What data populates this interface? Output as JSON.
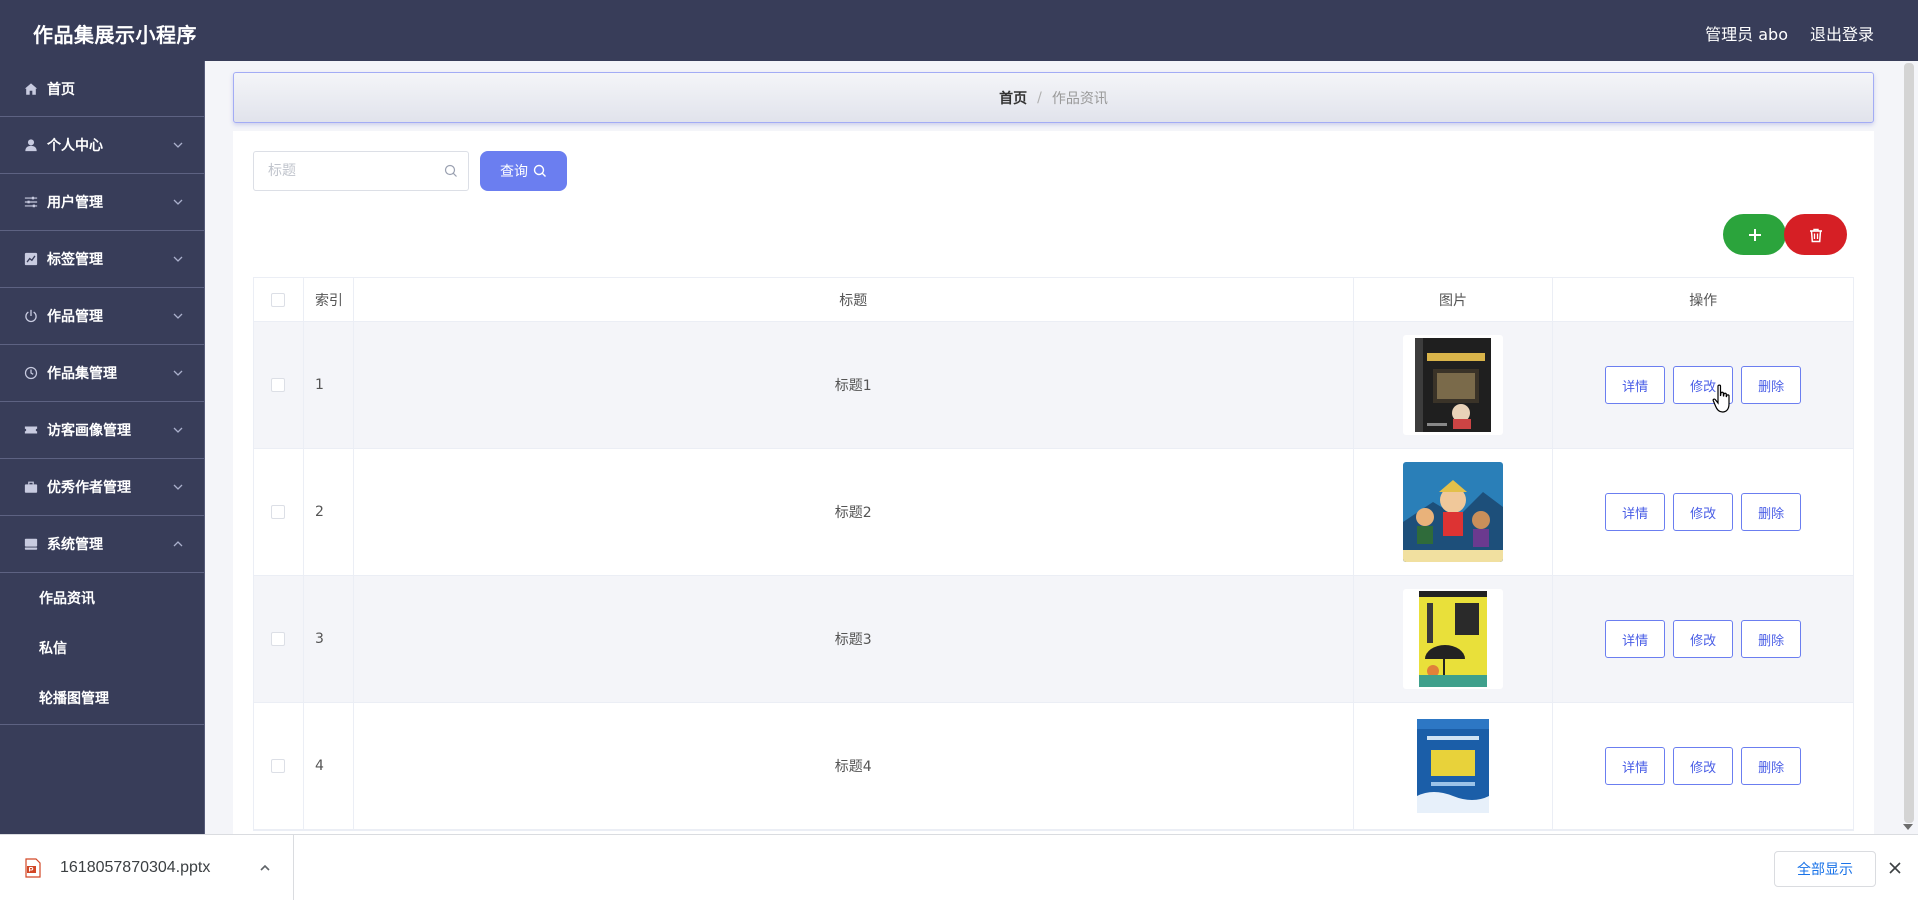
{
  "header": {
    "app_title": "作品集展示小程序",
    "user_text": "管理员 abo",
    "logout_label": "退出登录"
  },
  "sidebar": {
    "items": [
      {
        "label": "首页",
        "icon": "home-icon"
      },
      {
        "label": "个人中心",
        "icon": "user-icon"
      },
      {
        "label": "用户管理",
        "icon": "sliders-icon"
      },
      {
        "label": "标签管理",
        "icon": "chart-icon"
      },
      {
        "label": "作品管理",
        "icon": "power-icon"
      },
      {
        "label": "作品集管理",
        "icon": "clock-icon"
      },
      {
        "label": "访客画像管理",
        "icon": "ticket-icon"
      },
      {
        "label": "优秀作者管理",
        "icon": "briefcase-icon"
      },
      {
        "label": "系统管理",
        "icon": "drive-icon"
      }
    ],
    "sub_items": [
      "作品资讯",
      "私信",
      "轮播图管理"
    ]
  },
  "breadcrumb": {
    "home": "首页",
    "separator": "/",
    "current": "作品资讯"
  },
  "search": {
    "placeholder": "标题",
    "query_label": "查询"
  },
  "table": {
    "headers": {
      "index": "索引",
      "title": "标题",
      "image": "图片",
      "ops": "操作"
    },
    "rows": [
      {
        "index": "1",
        "title": "标题1"
      },
      {
        "index": "2",
        "title": "标题2"
      },
      {
        "index": "3",
        "title": "标题3"
      },
      {
        "index": "4",
        "title": "标题4"
      }
    ],
    "op_labels": {
      "detail": "详情",
      "edit": "修改",
      "delete": "删除"
    }
  },
  "download_bar": {
    "file_name": "1618057870304.pptx",
    "show_all_label": "全部显示"
  },
  "colors": {
    "sidebar_bg": "#383d59",
    "accent": "#6b7ef0",
    "add_green": "#2ba43c",
    "delete_red": "#d61f25"
  }
}
